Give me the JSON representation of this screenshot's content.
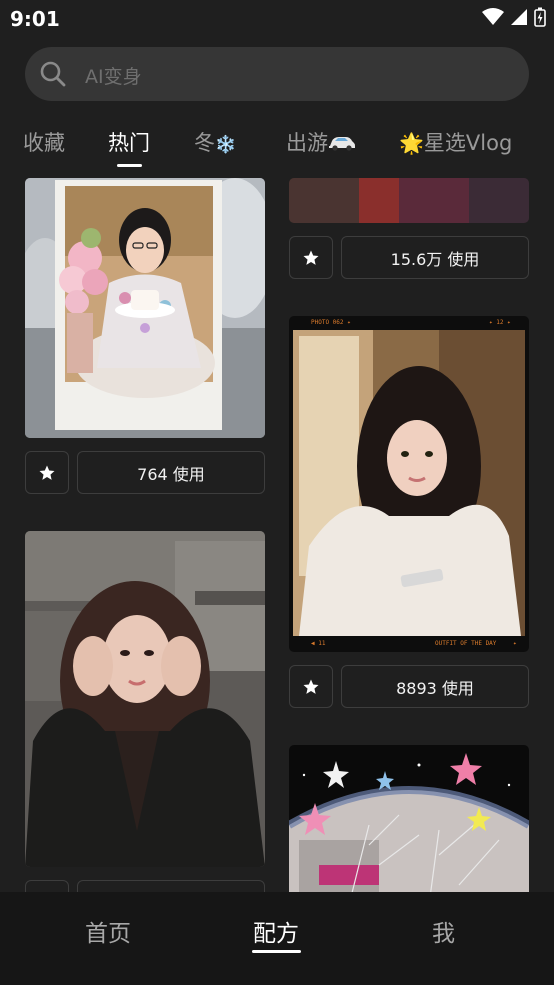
{
  "status_bar": {
    "time": "9:01"
  },
  "search": {
    "placeholder": "AI变身"
  },
  "tabs": [
    {
      "label": "收藏"
    },
    {
      "label": "热门"
    },
    {
      "label": "冬",
      "emoji": "❄️"
    },
    {
      "label": "出游",
      "emoji": "🚗"
    },
    {
      "emoji": "🌟",
      "label": "星选Vlog"
    }
  ],
  "feed": {
    "cards": [
      {
        "usage": "764 使用"
      },
      {
        "usage": "15.6万 使用"
      },
      {
        "usage": "8893 使用"
      }
    ],
    "card_photo_texts": {
      "top_left": "PHOTO 062 ✦",
      "top_right": "✦ 12 ✦",
      "bottom_left": "◀ 11",
      "bottom_mid": "OUTFIT OF THE DAY",
      "bottom_right": "✦"
    }
  },
  "bottom_nav": [
    {
      "label": "首页"
    },
    {
      "label": "配方"
    },
    {
      "label": "我"
    }
  ],
  "colors": {
    "background": "#1f1f1f",
    "search_bg": "#363636",
    "nav_bg": "#161616",
    "active": "#ffffff",
    "inactive": "#9a9a9a"
  }
}
